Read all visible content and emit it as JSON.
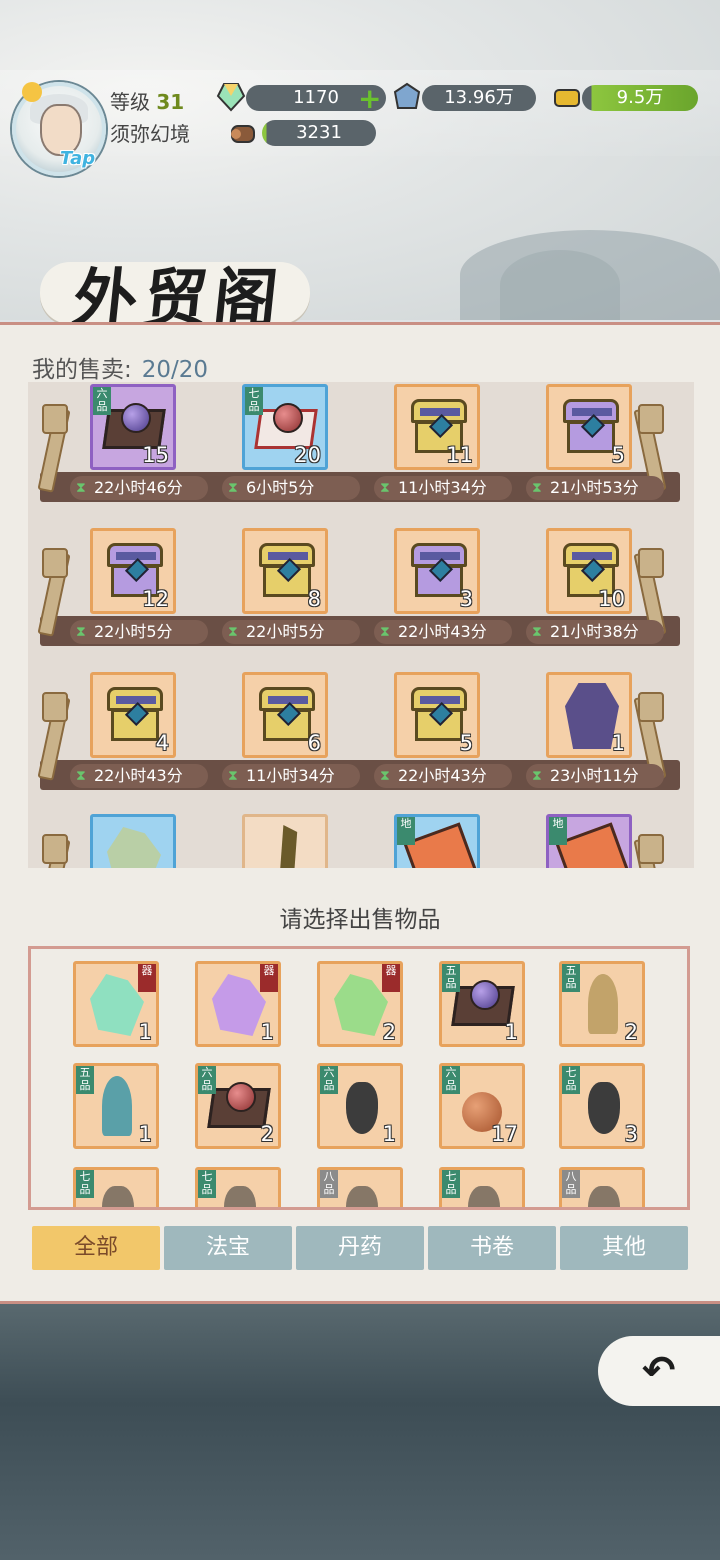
{
  "player": {
    "level_label": "等级",
    "level": "31",
    "realm": "须弥幻境",
    "tap": "Tap"
  },
  "resources": {
    "jade": "1170",
    "crystal": "13.96万",
    "gold": "9.5万",
    "wood": "3231"
  },
  "page_title": "外贸阁",
  "my_sales": {
    "label": "我的售卖:",
    "count": "20/20"
  },
  "shelf_items": [
    {
      "icon": "purple-box-icon",
      "rarity": "purple",
      "count": "15",
      "grade": "六品",
      "timer": "22小时46分"
    },
    {
      "icon": "red-orb-talisman-icon",
      "rarity": "blue",
      "count": "20",
      "grade": "七品",
      "timer": "6小时5分"
    },
    {
      "icon": "gold-chest-icon",
      "rarity": "orange",
      "count": "11",
      "grade": "",
      "timer": "11小时34分"
    },
    {
      "icon": "violet-chest-icon",
      "rarity": "orange",
      "count": "5",
      "grade": "",
      "timer": "21小时53分"
    },
    {
      "icon": "violet-chest-icon",
      "rarity": "orange",
      "count": "12",
      "grade": "",
      "timer": "22小时5分"
    },
    {
      "icon": "gold-chest-icon",
      "rarity": "orange",
      "count": "8",
      "grade": "",
      "timer": "22小时5分"
    },
    {
      "icon": "violet-chest-icon",
      "rarity": "orange",
      "count": "3",
      "grade": "",
      "timer": "22小时43分"
    },
    {
      "icon": "gold-chest-icon",
      "rarity": "orange",
      "count": "10",
      "grade": "",
      "timer": "21小时38分"
    },
    {
      "icon": "gold-chest-icon",
      "rarity": "orange",
      "count": "4",
      "grade": "",
      "timer": "22小时43分"
    },
    {
      "icon": "gold-chest-icon",
      "rarity": "orange",
      "count": "6",
      "grade": "",
      "timer": "11小时34分"
    },
    {
      "icon": "gold-chest-icon",
      "rarity": "orange",
      "count": "5",
      "grade": "",
      "timer": "22小时43分"
    },
    {
      "icon": "robe-icon",
      "rarity": "orange",
      "count": "1",
      "grade": "",
      "timer": "23小时11分"
    },
    {
      "icon": "jade-crystal-icon",
      "rarity": "blue",
      "count": "",
      "grade": "",
      "timer": ""
    },
    {
      "icon": "sword-icon",
      "rarity": "plain",
      "count": "",
      "grade": "",
      "timer": ""
    },
    {
      "icon": "scroll-icon",
      "rarity": "blue",
      "count": "",
      "grade": "地",
      "timer": ""
    },
    {
      "icon": "scroll-icon",
      "rarity": "purple",
      "count": "",
      "grade": "地",
      "timer": ""
    }
  ],
  "select_title": "请选择出售物品",
  "inventory": [
    {
      "icon": "teal-crystal-icon",
      "count": "1",
      "grade": "器"
    },
    {
      "icon": "purple-crystal-icon",
      "count": "1",
      "grade": "器"
    },
    {
      "icon": "green-crystal-icon",
      "count": "2",
      "grade": "器"
    },
    {
      "icon": "purple-orb-box-icon",
      "count": "1",
      "grade": "五品"
    },
    {
      "icon": "gourd-figure-icon",
      "count": "2",
      "grade": "五品"
    },
    {
      "icon": "teal-figure-icon",
      "count": "1",
      "grade": "五品"
    },
    {
      "icon": "red-orb-box-icon",
      "count": "2",
      "grade": "六品"
    },
    {
      "icon": "black-gourd-icon",
      "count": "1",
      "grade": "六品"
    },
    {
      "icon": "peach-icon",
      "count": "17",
      "grade": "六品"
    },
    {
      "icon": "black-gourd-icon",
      "count": "3",
      "grade": "七品"
    },
    {
      "icon": "unknown-item-icon",
      "count": "",
      "grade": "七品"
    },
    {
      "icon": "unknown-item-icon",
      "count": "",
      "grade": "七品"
    },
    {
      "icon": "unknown-item-icon",
      "count": "",
      "grade": "八品"
    },
    {
      "icon": "unknown-item-icon",
      "count": "",
      "grade": "七品"
    },
    {
      "icon": "unknown-item-icon",
      "count": "",
      "grade": "八品"
    }
  ],
  "tabs": [
    "全部",
    "法宝",
    "丹药",
    "书卷",
    "其他"
  ],
  "active_tab": "全部",
  "back_icon": "back-arrow-icon"
}
